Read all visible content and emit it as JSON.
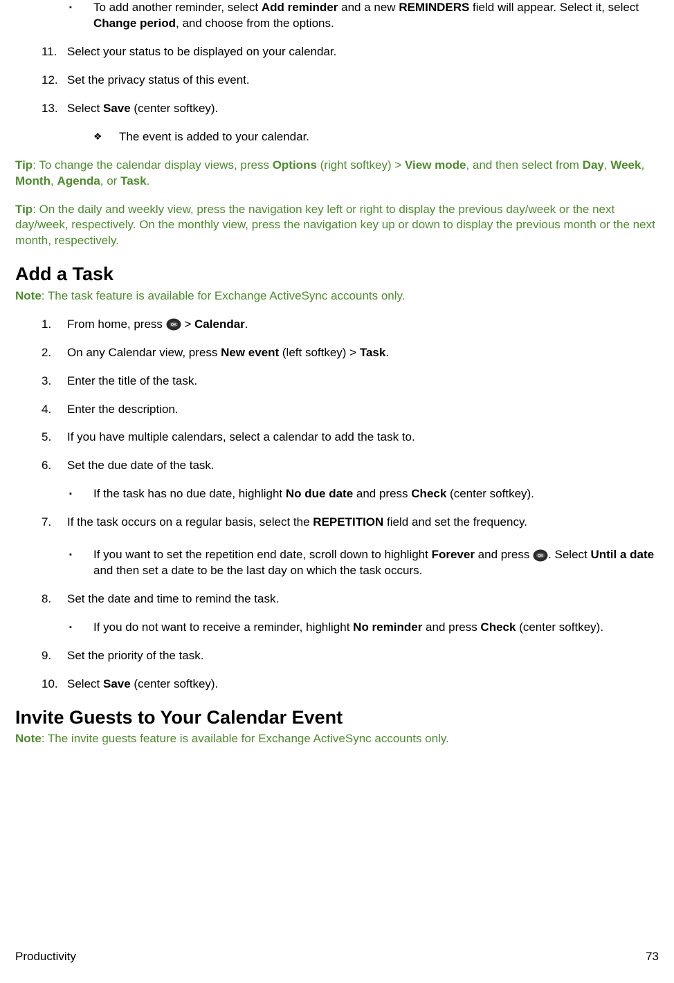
{
  "topBullet": {
    "prefix": "To add another reminder, select ",
    "b1": "Add reminder",
    "mid1": " and a new ",
    "b2": "REMINDERS",
    "mid2": " field will appear. Select it, select ",
    "b3": "Change period",
    "suffix": ", and choose from the options."
  },
  "items": {
    "n11": "11.",
    "t11": "Select your status to be displayed on your calendar.",
    "n12": "12.",
    "t12": "Set the privacy status of this event.",
    "n13": "13.",
    "t13a": "Select ",
    "t13b": "Save",
    "t13c": " (center softkey).",
    "diamond": "The event is added to your calendar."
  },
  "tip1": {
    "lead": "Tip",
    "t1": ": To change the calendar display views, press ",
    "b1": "Options",
    "t2": " (right softkey) > ",
    "b2": "View mode",
    "t3": ", and then select from ",
    "b3": "Day",
    "c1": ", ",
    "b4": "Week",
    "c2": ", ",
    "b5": "Month",
    "c3": ", ",
    "b6": "Agenda",
    "c4": ", or ",
    "b7": "Task",
    "end": "."
  },
  "tip2": {
    "lead": "Tip",
    "text": ": On the daily and weekly view, press the navigation key left or right to display the previous day/week or the next day/week, respectively. On the monthly view, press the navigation key up or down to display the previous month or the next month, respectively."
  },
  "h_task": "Add a Task",
  "note_task": {
    "lead": "Note",
    "text": ": The task feature is available for Exchange ActiveSync accounts only."
  },
  "task": {
    "n1": "1.",
    "t1a": "From home, press ",
    "t1b": " > ",
    "t1c": "Calendar",
    "t1d": ".",
    "n2": "2.",
    "t2a": "On any Calendar view, press ",
    "t2b": "New event",
    "t2c": " (left softkey)  > ",
    "t2d": "Task",
    "t2e": ".",
    "n3": "3.",
    "t3": "Enter the title of the task.",
    "n4": "4.",
    "t4": "Enter the description.",
    "n5": "5.",
    "t5": "If you have multiple calendars, select a calendar to add the task to.",
    "n6": "6.",
    "t6": "Set the due date of the task.",
    "s6a": "If the task has no due date, highlight ",
    "s6b": "No due date",
    "s6c": " and press ",
    "s6d": "Check",
    "s6e": " (center softkey).",
    "n7": "7.",
    "t7a": "If the task occurs on a regular basis, select the ",
    "t7b": "REPETITION",
    "t7c": " field and set the frequency.",
    "s7a": "If you want to set the repetition end date, scroll down to highlight ",
    "s7b": "Forever",
    "s7c": " and press ",
    "s7d": ". Select ",
    "s7e": "Until a date",
    "s7f": " and then set a date to be the last day on which the task occurs.",
    "n8": "8.",
    "t8": "Set the date and time to remind the task.",
    "s8a": "If you do not want to receive a reminder, highlight ",
    "s8b": "No reminder",
    "s8c": " and press ",
    "s8d": "Check",
    "s8e": " (center softkey).",
    "n9": "9.",
    "t9": "Set the priority of the task.",
    "n10": "10.",
    "t10a": "Select ",
    "t10b": "Save",
    "t10c": " (center softkey)."
  },
  "h_invite": "Invite Guests to Your Calendar Event",
  "note_invite": {
    "lead": "Note",
    "text": ": The invite guests feature is available for Exchange ActiveSync accounts only."
  },
  "footer": {
    "left": "Productivity",
    "right": "73"
  }
}
